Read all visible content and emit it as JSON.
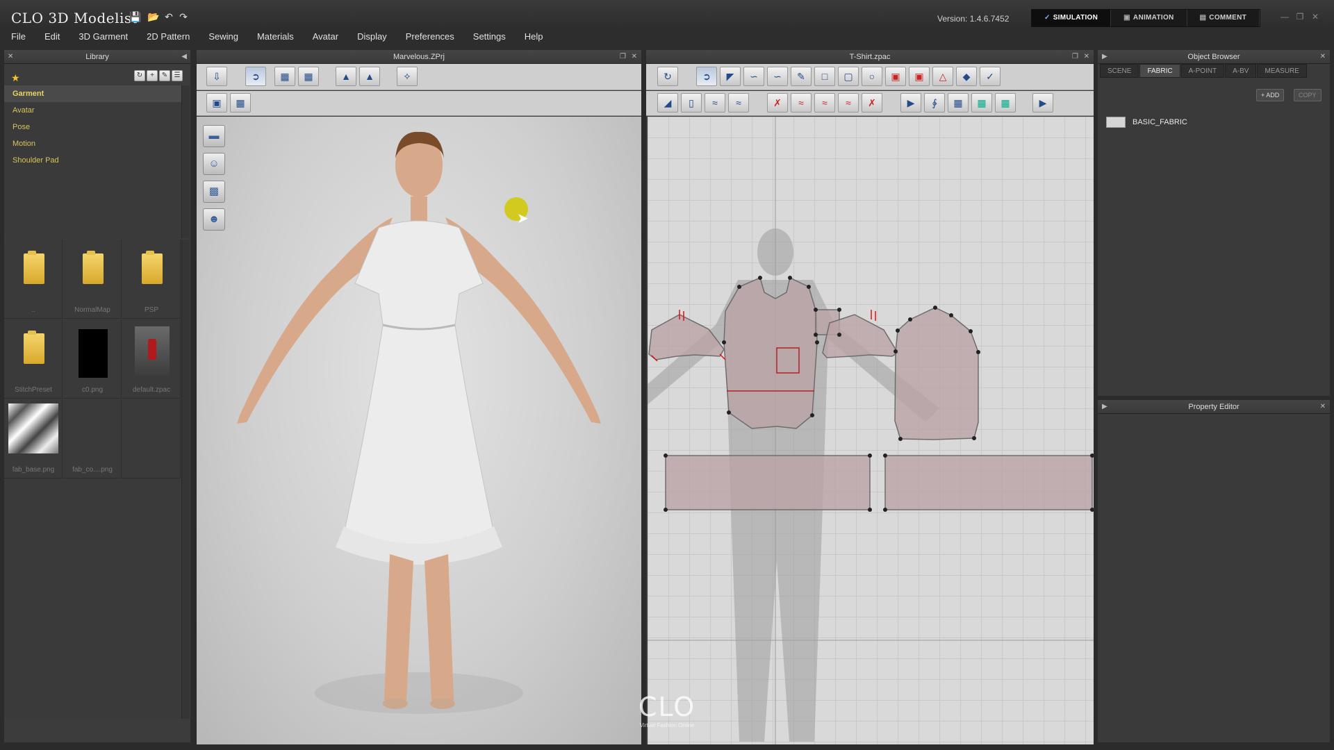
{
  "app": {
    "logo": "CLO 3D Modelist",
    "version": "Version:  1.4.6.7452",
    "modes": [
      {
        "label": "SIMULATION",
        "icon": "simulation-icon"
      },
      {
        "label": "ANIMATION",
        "icon": "animation-icon"
      },
      {
        "label": "COMMENT",
        "icon": "comment-icon"
      }
    ],
    "active_mode": "SIMULATION"
  },
  "menu": [
    "File",
    "Edit",
    "3D Garment",
    "2D Pattern",
    "Sewing",
    "Materials",
    "Avatar",
    "Display",
    "Preferences",
    "Settings",
    "Help"
  ],
  "library": {
    "title": "Library",
    "tree": [
      "Garment",
      "Avatar",
      "Pose",
      "Motion",
      "Shoulder Pad"
    ],
    "selected": "Garment",
    "thumbnails": [
      {
        "label": "..",
        "kind": "folder"
      },
      {
        "label": "NormalMap",
        "kind": "folder"
      },
      {
        "label": "PSP",
        "kind": "folder"
      },
      {
        "label": "StitchPreset",
        "kind": "folder"
      },
      {
        "label": "c0.png",
        "kind": "image-black"
      },
      {
        "label": "default.zpac",
        "kind": "garment"
      },
      {
        "label": "fab_base.png",
        "kind": "fabric"
      },
      {
        "label": "fab_co....png",
        "kind": "blank"
      }
    ]
  },
  "view3d": {
    "title": "Marvelous.ZPrj"
  },
  "view2d": {
    "title": "T-Shirt.zpac"
  },
  "object_browser": {
    "title": "Object Browser",
    "tabs": [
      "SCENE",
      "FABRIC",
      "A-POINT",
      "A-BV",
      "MEASURE"
    ],
    "active_tab": "FABRIC",
    "add_label": "ADD",
    "copy_label": "COPY",
    "fabrics": [
      "BASIC_FABRIC"
    ]
  },
  "property_editor": {
    "title": "Property Editor"
  },
  "watermark": {
    "logo": "CLO",
    "tagline": "Virtual Fashion Online"
  },
  "colors": {
    "accent": "#7fb6ff",
    "library_text": "#d8c45a",
    "pattern_fill": "#b9a3a6",
    "cursor": "#d2c800"
  }
}
